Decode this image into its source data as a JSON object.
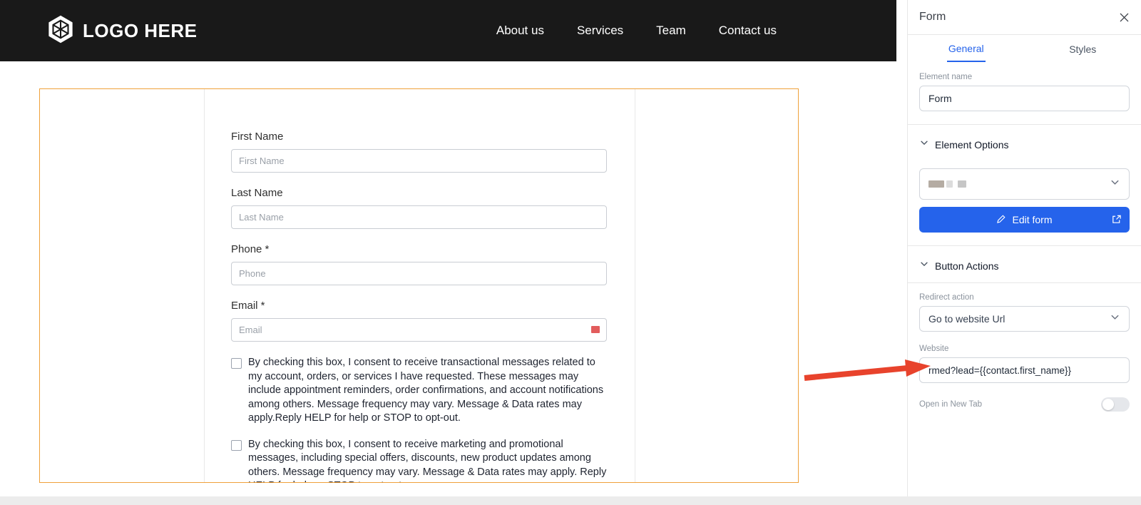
{
  "site": {
    "logo": "LOGO HERE",
    "nav": [
      "About us",
      "Services",
      "Team",
      "Contact us"
    ],
    "form": {
      "fields": [
        {
          "label": "First Name",
          "placeholder": "First Name"
        },
        {
          "label": "Last Name",
          "placeholder": "Last Name"
        },
        {
          "label": "Phone *",
          "placeholder": "Phone"
        },
        {
          "label": "Email *",
          "placeholder": "Email"
        }
      ],
      "consents": [
        "By checking this box, I consent to receive transactional messages related to my account, orders, or services I have requested. These messages may include appointment reminders, order confirmations, and account notifications among others. Message frequency may vary. Message & Data rates may apply.Reply HELP for help or STOP to opt-out.",
        "By checking this box, I consent to receive marketing and promotional messages, including special offers, discounts, new product updates among others. Message frequency may vary. Message & Data rates may apply. Reply HELP for help or STOP to opt-out."
      ]
    }
  },
  "panel": {
    "title": "Form",
    "tabs": [
      {
        "label": "General",
        "active": true
      },
      {
        "label": "Styles",
        "active": false
      }
    ],
    "element_name_label": "Element name",
    "element_name_value": "Form",
    "element_options_title": "Element Options",
    "edit_form_label": "Edit form",
    "button_actions_title": "Button Actions",
    "redirect_label": "Redirect action",
    "redirect_value": "Go to website Url",
    "website_label": "Website",
    "website_value": "rmed?lead={{contact.first_name}}",
    "open_new_tab_label": "Open in New Tab",
    "open_new_tab_enabled": false
  },
  "colors": {
    "navbar": "#191919",
    "accent_blue": "#2563eb",
    "form_border_orange": "#efa13b",
    "annotation_arrow_red": "#e8432c",
    "email_flag_red": "#e25c5c"
  }
}
